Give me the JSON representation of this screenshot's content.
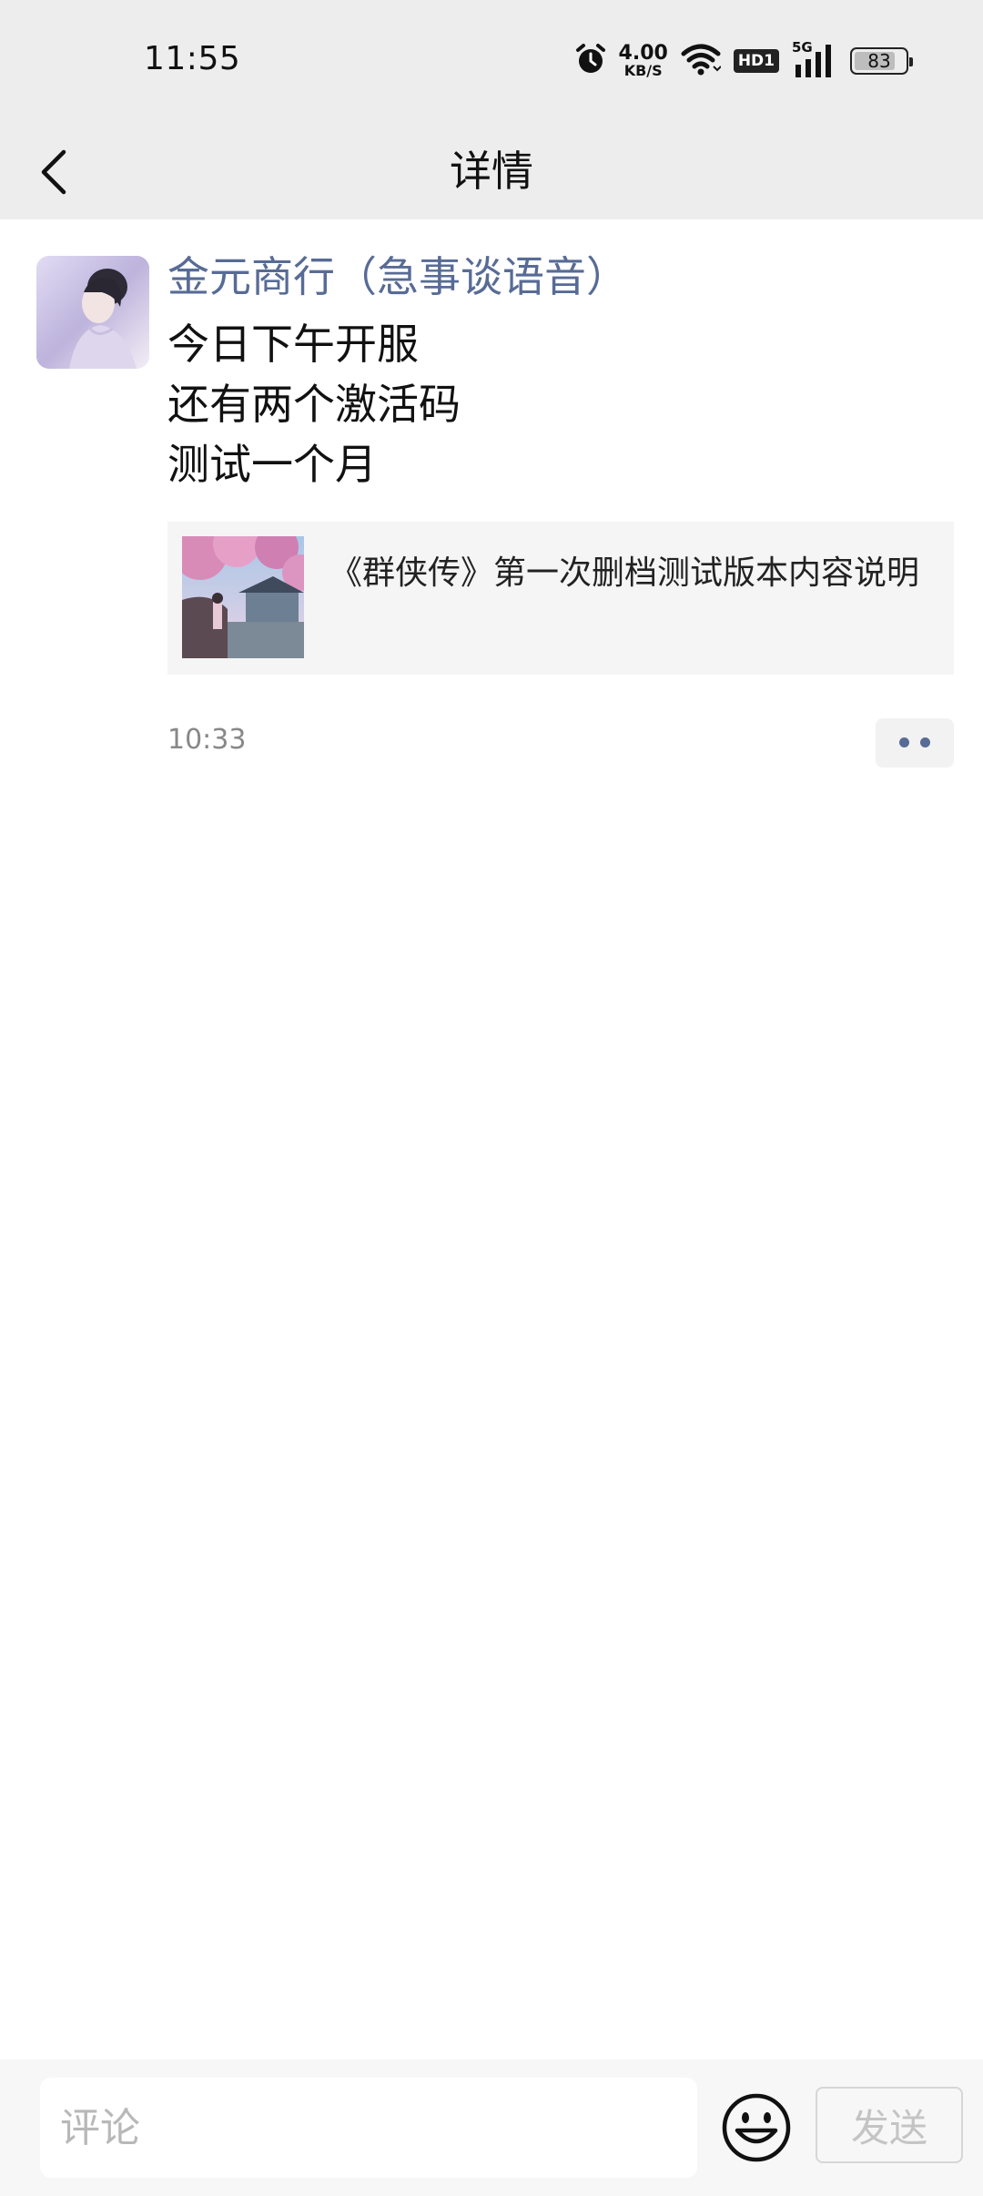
{
  "status_bar": {
    "time": "11:55",
    "net_speed_value": "4.00",
    "net_speed_unit": "KB/S",
    "hd_label": "HD1",
    "network_label": "5G",
    "battery_level": "83",
    "icons": [
      "alarm-icon",
      "wifi-icon",
      "signal-icon",
      "battery-icon"
    ]
  },
  "header": {
    "title": "详情",
    "back_icon": "chevron-left-icon"
  },
  "post": {
    "author": "金元商行（急事谈语音）",
    "lines": [
      "今日下午开服",
      "还有两个激活码",
      "测试一个月"
    ],
    "link_card": {
      "title": "《群侠传》第一次删档测试版本内容说明"
    },
    "time": "10:33",
    "more_icon": "more-dots-icon"
  },
  "comment_bar": {
    "placeholder": "评论",
    "emoji_icon": "emoji-icon",
    "send_label": "发送"
  },
  "colors": {
    "bar_background": "#ededed",
    "author_name": "#576b95",
    "text": "#111111",
    "meta": "#888888"
  }
}
